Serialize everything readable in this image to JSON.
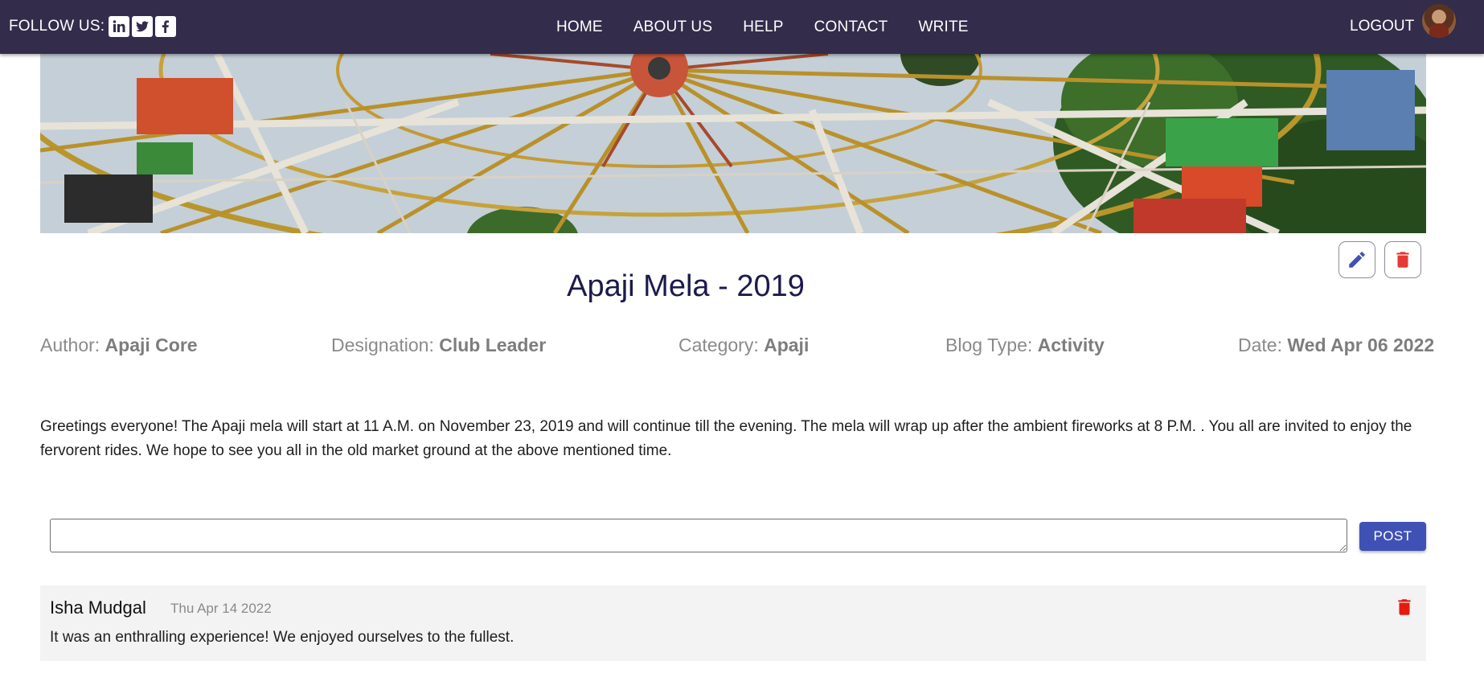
{
  "navbar": {
    "follow_label": "FOLLOW US:",
    "social_icons": [
      "linkedin-icon",
      "twitter-icon",
      "facebook-icon"
    ],
    "links": [
      "HOME",
      "ABOUT US",
      "HELP",
      "CONTACT",
      "WRITE"
    ],
    "logout_label": "LOGOUT"
  },
  "post": {
    "title": "Apaji Mela - 2019",
    "author_label": "Author:",
    "author": "Apaji Core",
    "designation_label": "Designation:",
    "designation": "Club Leader",
    "category_label": "Category:",
    "category": "Apaji",
    "blog_type_label": "Blog Type:",
    "blog_type": "Activity",
    "date_label": "Date:",
    "date": "Wed Apr 06 2022",
    "content": "Greetings everyone! The Apaji mela will start at 11 A.M. on November 23, 2019 and will continue till the evening. The mela will wrap up after the ambient fireworks at 8 P.M. . You all are invited to enjoy the fervorent rides. We hope to see you all in the old market ground at the above mentioned time."
  },
  "comment_form": {
    "value": "",
    "post_label": "POST"
  },
  "comments": [
    {
      "author": "Isha Mudgal",
      "date": "Thu Apr 14 2022",
      "text": "It was an enthralling experience! We enjoyed ourselves to the fullest."
    }
  ],
  "colors": {
    "navbar_bg": "#332c4b",
    "title": "#1d1a4d",
    "accent": "#3f51b5",
    "delete": "#e53935"
  }
}
